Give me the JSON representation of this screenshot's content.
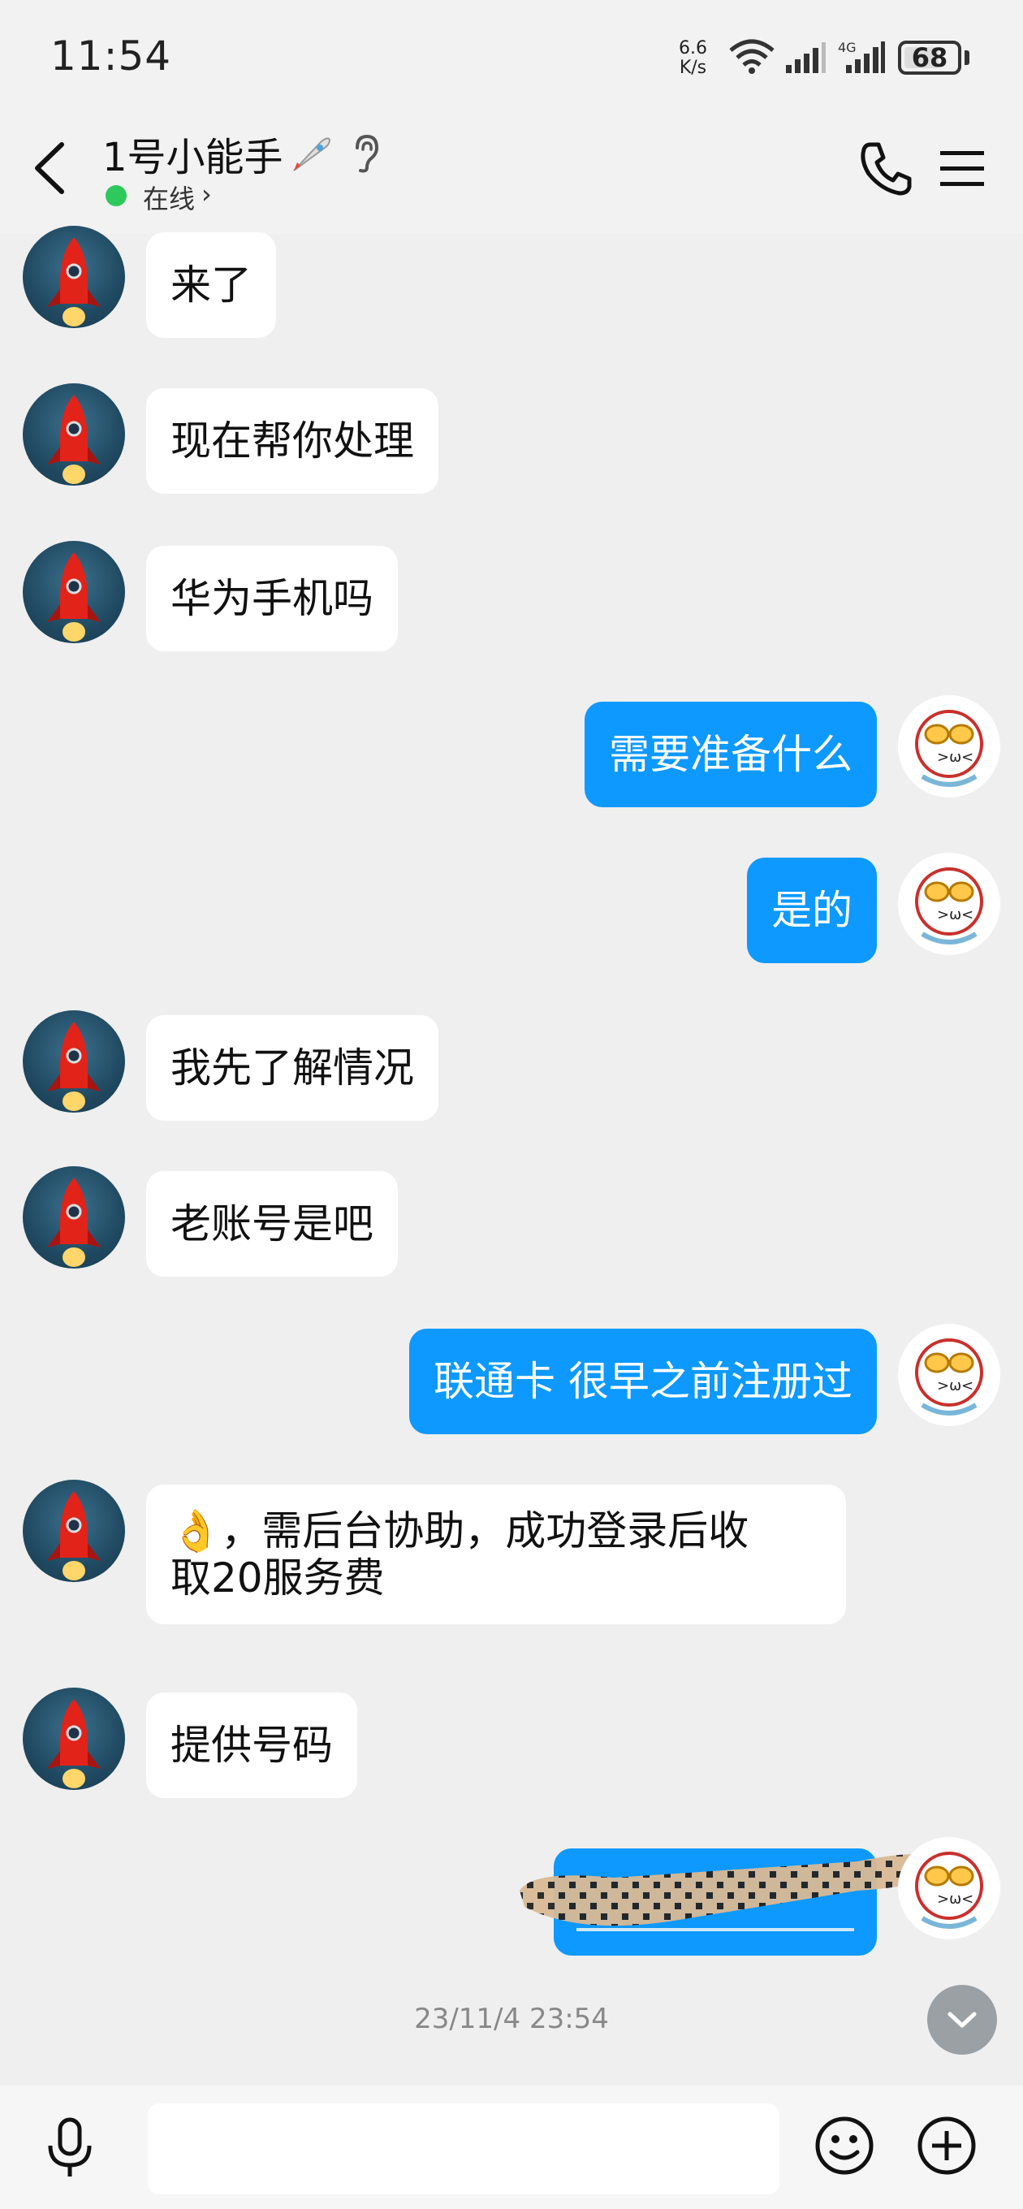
{
  "status": {
    "time": "11:54",
    "speed_value": "6.6",
    "speed_unit": "K/s",
    "signal1_label": "6",
    "signal2_label": "4G",
    "battery": "68"
  },
  "header": {
    "title": "1号小能手",
    "status": "在线",
    "status_chevron": "›"
  },
  "messages": [
    {
      "side": "in",
      "text": "来了"
    },
    {
      "side": "in",
      "text": "现在帮你处理"
    },
    {
      "side": "in",
      "text": "华为手机吗"
    },
    {
      "side": "out",
      "text": "需要准备什么"
    },
    {
      "side": "out",
      "text": "是的"
    },
    {
      "side": "in",
      "text": "我先了解情况"
    },
    {
      "side": "in",
      "text": "老账号是吧"
    },
    {
      "side": "out",
      "text": "联通卡 很早之前注册过"
    },
    {
      "side": "in",
      "line1": "👌，需后台协助，成功登录后收",
      "line2": "取20服务费"
    },
    {
      "side": "in",
      "text": "提供号码"
    },
    {
      "side": "out",
      "text": "",
      "redacted": true
    }
  ],
  "timestamp": "23/11/4 23:54",
  "input": {
    "placeholder": ""
  },
  "colors": {
    "outgoing_bubble": "#0d99ff",
    "incoming_bubble": "#ffffff",
    "online": "#2ec95c"
  }
}
